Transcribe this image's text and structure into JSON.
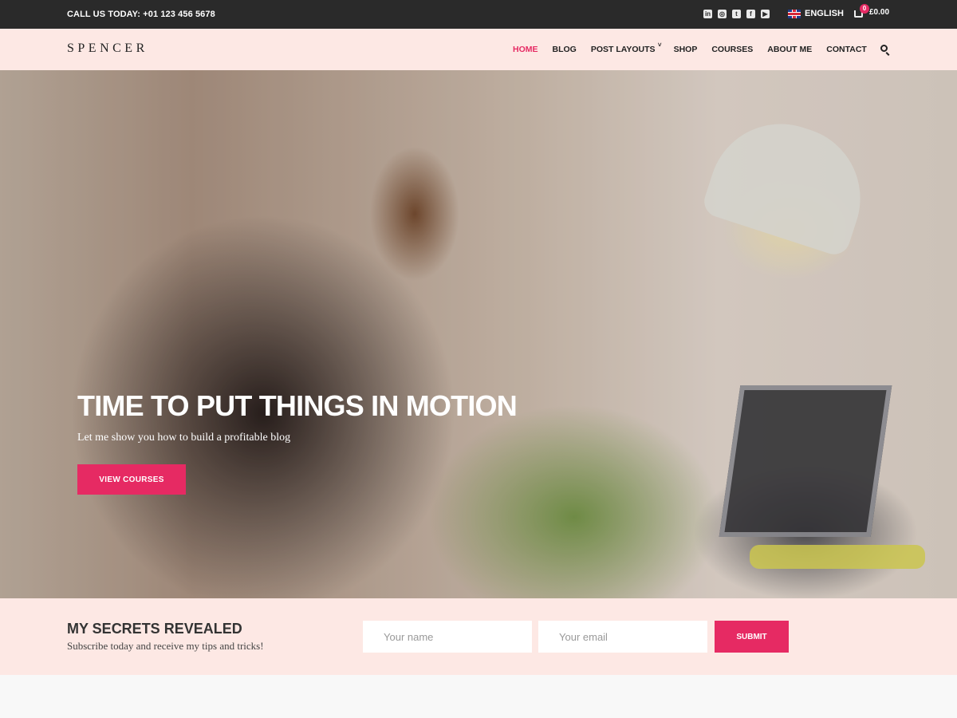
{
  "topbar": {
    "call_text": "CALL US TODAY: +01 123 456 5678",
    "social_icons": [
      "linkedin-icon",
      "instagram-icon",
      "twitter-icon",
      "facebook-icon",
      "youtube-icon"
    ],
    "social_glyphs": [
      "in",
      "◎",
      "t",
      "f",
      "▶"
    ],
    "language": "ENGLISH",
    "cart_count": "0",
    "cart_total": "£0.00"
  },
  "header": {
    "logo": "SPENCER",
    "nav": [
      {
        "label": "HOME",
        "active": true
      },
      {
        "label": "BLOG"
      },
      {
        "label": "POST LAYOUTS",
        "has_submenu": true
      },
      {
        "label": "SHOP"
      },
      {
        "label": "COURSES"
      },
      {
        "label": "ABOUT ME"
      },
      {
        "label": "CONTACT"
      }
    ],
    "chevron": "˅"
  },
  "hero": {
    "title": "TIME TO PUT THINGS IN MOTION",
    "subtitle": "Let me show you how to build a profitable blog",
    "cta_label": "VIEW COURSES"
  },
  "subscribe": {
    "title": "MY SECRETS REVEALED",
    "text": "Subscribe today and receive my tips and tricks!",
    "name_placeholder": "Your name",
    "email_placeholder": "Your email",
    "submit_label": "SUBMIT"
  },
  "colors": {
    "accent": "#e62a63",
    "topbar_bg": "#2a2a2a",
    "header_bg": "#fde8e4"
  }
}
